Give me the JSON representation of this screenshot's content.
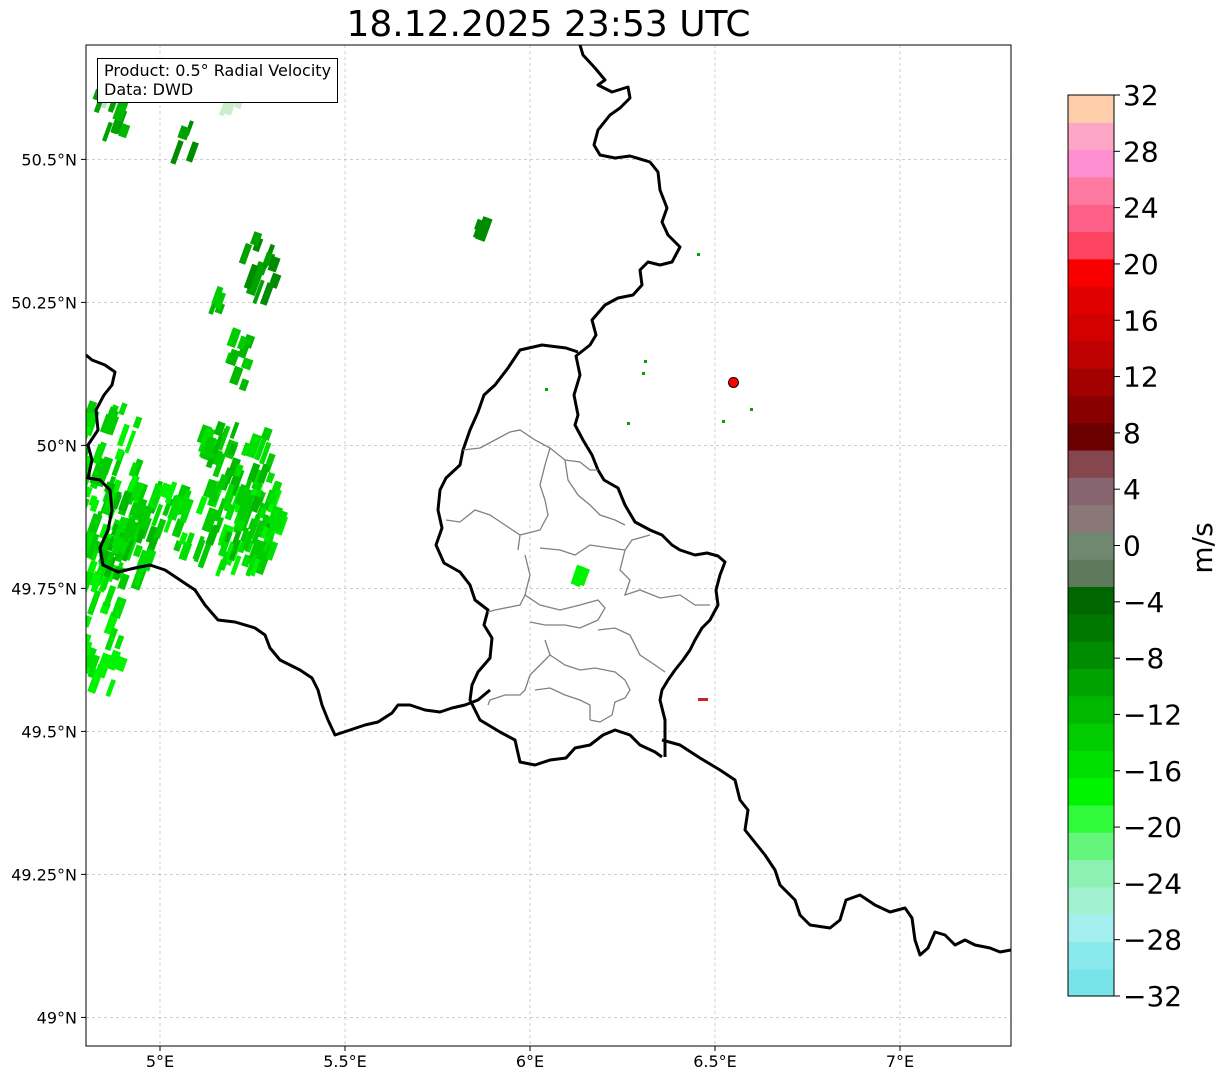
{
  "title": "18.12.2025 23:53 UTC",
  "info": {
    "product_line": "Product: 0.5° Radial Velocity",
    "data_line": "Data: DWD"
  },
  "lon_ticks": [
    {
      "value": 5.0,
      "label": "5°E"
    },
    {
      "value": 5.5,
      "label": "5.5°E"
    },
    {
      "value": 6.0,
      "label": "6°E"
    },
    {
      "value": 6.5,
      "label": "6.5°E"
    },
    {
      "value": 7.0,
      "label": "7°E"
    }
  ],
  "lat_ticks": [
    {
      "value": 50.5,
      "label": "50.5°N"
    },
    {
      "value": 50.25,
      "label": "50.25°N"
    },
    {
      "value": 50.0,
      "label": "50°N"
    },
    {
      "value": 49.75,
      "label": "49.75°N"
    },
    {
      "value": 49.5,
      "label": "49.5°N"
    },
    {
      "value": 49.25,
      "label": "49.25°N"
    },
    {
      "value": 49.0,
      "label": "49°N"
    }
  ],
  "extent": {
    "lon_min": 4.8,
    "lon_max": 7.3,
    "lat_min": 48.95,
    "lat_max": 50.7
  },
  "colorbar": {
    "label": "m/s",
    "min": -32,
    "max": 32,
    "tick_labels": [
      "32",
      "28",
      "24",
      "20",
      "16",
      "12",
      "8",
      "4",
      "0",
      "−4",
      "−8",
      "−12",
      "−16",
      "−20",
      "−24",
      "−28",
      "−32"
    ],
    "colors_bottom_to_top": [
      "#76e4e8",
      "#8ae9ec",
      "#a4eff0",
      "#a2f2cf",
      "#8cf2b4",
      "#64f57c",
      "#2ffb3a",
      "#00f400",
      "#00e000",
      "#00cc00",
      "#00b800",
      "#00a200",
      "#008c00",
      "#007800",
      "#006600",
      "#5e7a5c",
      "#708870",
      "#8a7878",
      "#876570",
      "#85464d",
      "#6a0000",
      "#880000",
      "#a30000",
      "#bd0000",
      "#d20000",
      "#e00000",
      "#f80000",
      "#fe4460",
      "#fe6088",
      "#fe7aa0",
      "#fe8ed0",
      "#fea6c6",
      "#ffcfac"
    ]
  },
  "radar_site": {
    "lon": 6.55,
    "lat": 50.11,
    "color": "#ff0000"
  },
  "colors": {
    "border": "#000000",
    "admin": "#808080",
    "grid": "#b0b0b0"
  }
}
